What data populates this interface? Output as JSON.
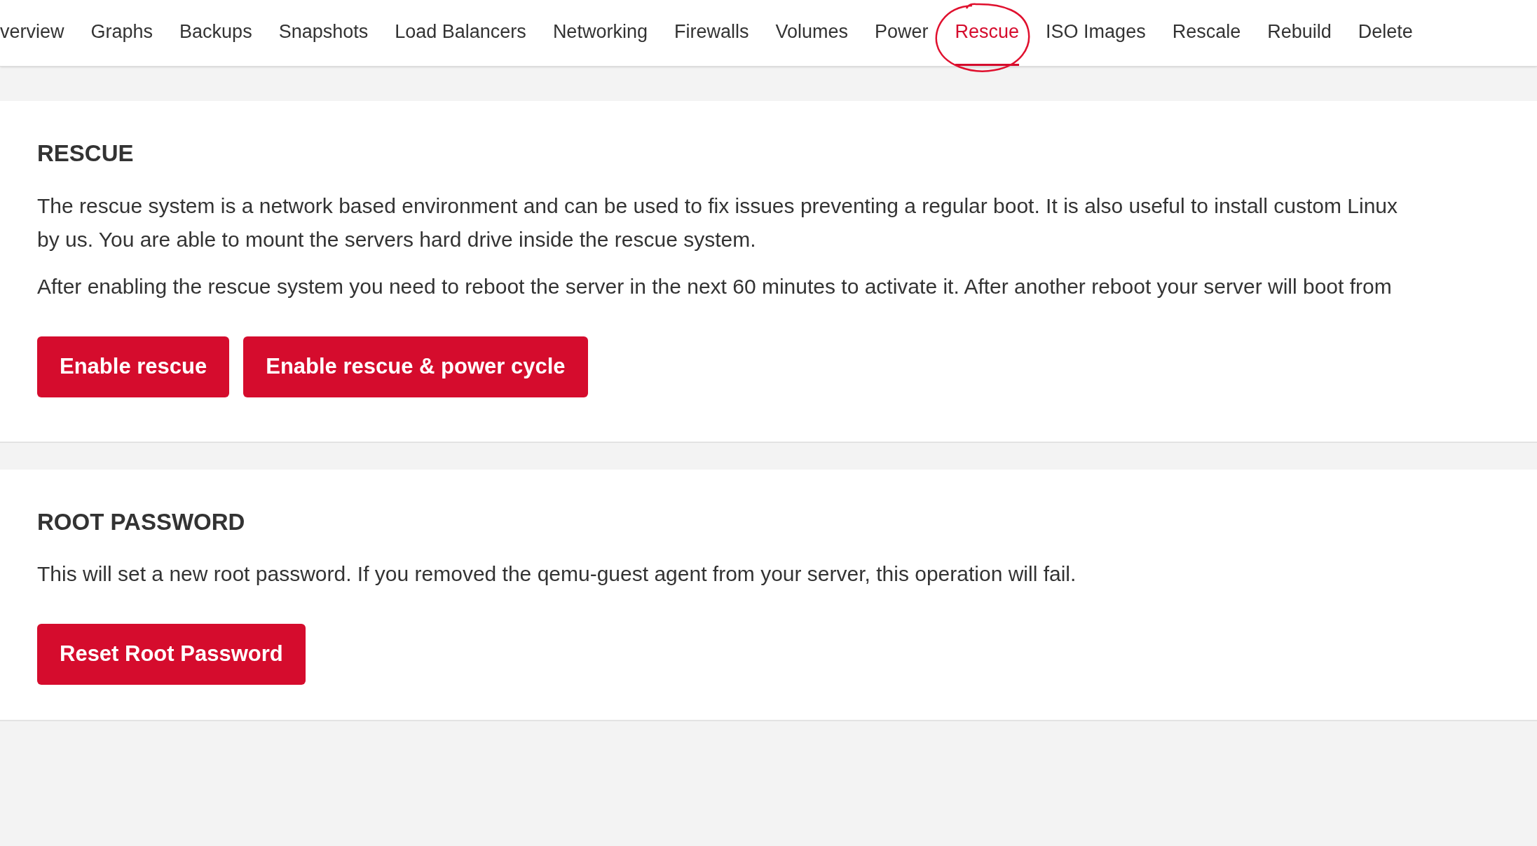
{
  "tabs": [
    {
      "label": "verview",
      "selected": false,
      "circled": false
    },
    {
      "label": "Graphs",
      "selected": false,
      "circled": false
    },
    {
      "label": "Backups",
      "selected": false,
      "circled": false
    },
    {
      "label": "Snapshots",
      "selected": false,
      "circled": false
    },
    {
      "label": "Load Balancers",
      "selected": false,
      "circled": false
    },
    {
      "label": "Networking",
      "selected": false,
      "circled": false
    },
    {
      "label": "Firewalls",
      "selected": false,
      "circled": false
    },
    {
      "label": "Volumes",
      "selected": false,
      "circled": false
    },
    {
      "label": "Power",
      "selected": false,
      "circled": false
    },
    {
      "label": "Rescue",
      "selected": true,
      "circled": true
    },
    {
      "label": "ISO Images",
      "selected": false,
      "circled": false
    },
    {
      "label": "Rescale",
      "selected": false,
      "circled": false
    },
    {
      "label": "Rebuild",
      "selected": false,
      "circled": false
    },
    {
      "label": "Delete",
      "selected": false,
      "circled": false
    }
  ],
  "sections": [
    {
      "title": "RESCUE",
      "paragraphs": [
        [
          "The rescue system is a network based environment and can be used to fix issues preventing a regular boot. It is also useful to install custom Linux",
          "by us. You are able to mount the servers hard drive inside the rescue system."
        ],
        [
          "After enabling the rescue system you need to reboot the server in the next 60 minutes to activate it. After another reboot your server will boot from"
        ]
      ],
      "buttons": [
        "Enable rescue",
        "Enable rescue & power cycle"
      ]
    },
    {
      "title": "ROOT PASSWORD",
      "paragraphs": [
        [
          "This will set a new root password. If you removed the qemu-guest agent from your server, this operation will fail."
        ]
      ],
      "buttons": [
        "Reset Root Password"
      ]
    }
  ]
}
